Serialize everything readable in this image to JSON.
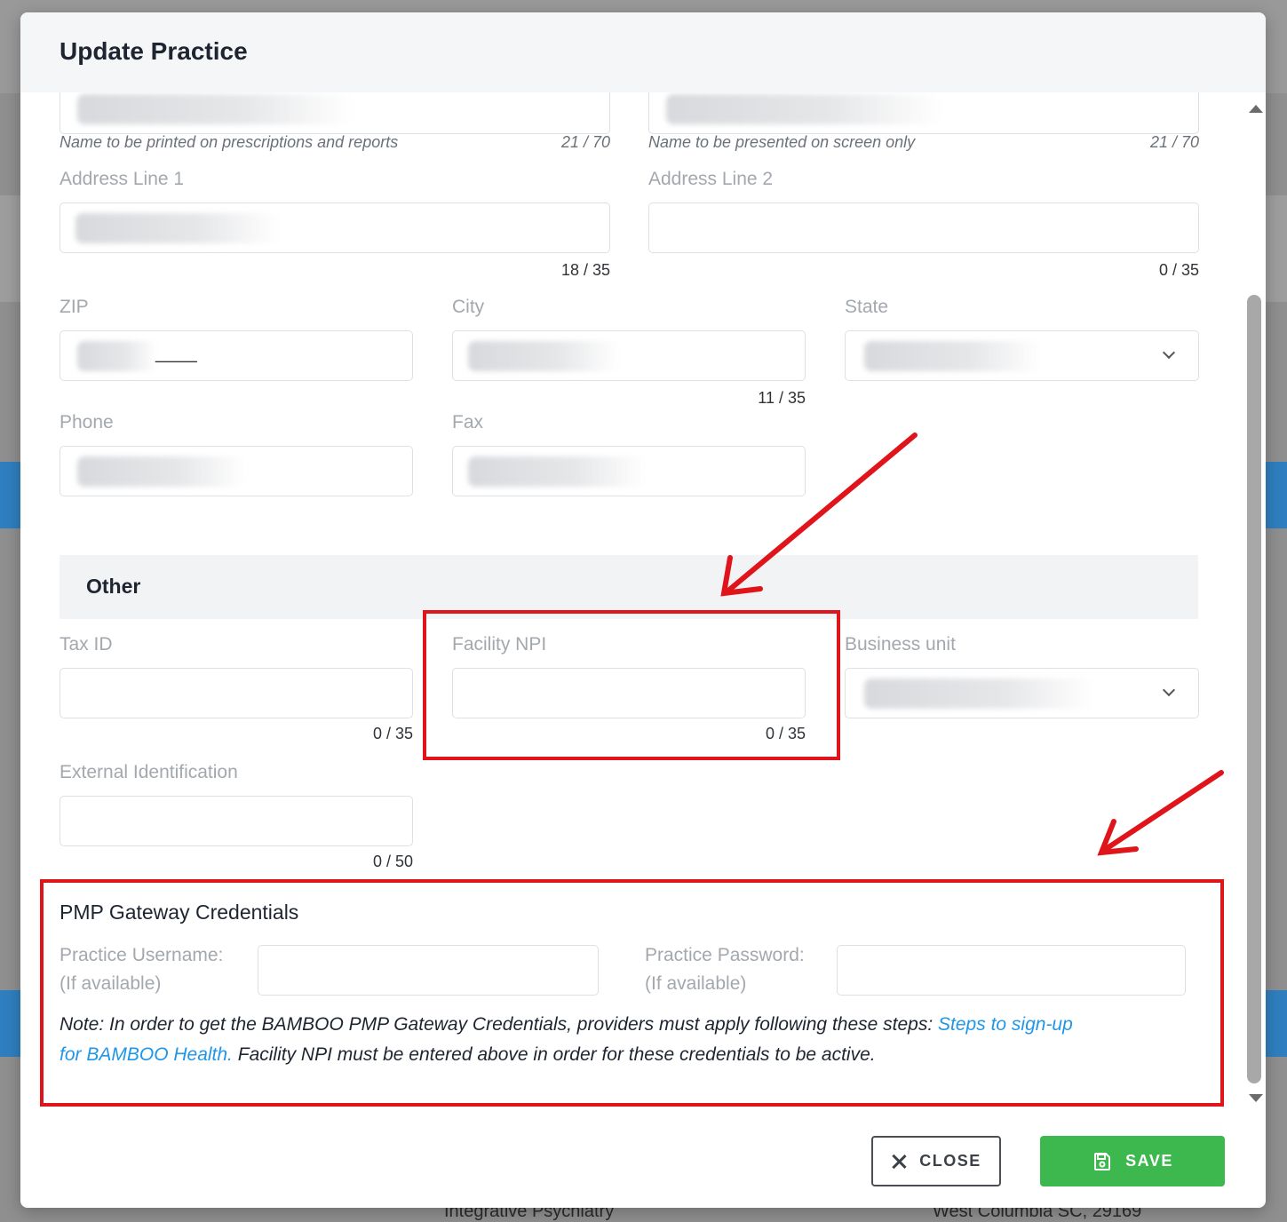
{
  "modal": {
    "title": "Update Practice"
  },
  "form": {
    "printed_name": {
      "hint": "Name to be printed on prescriptions and reports",
      "counter": "21 / 70"
    },
    "screen_name": {
      "hint": "Name to be presented on screen only",
      "counter": "21 / 70"
    },
    "address1": {
      "label": "Address Line 1",
      "counter": "18 / 35"
    },
    "address2": {
      "label": "Address Line 2",
      "counter": "0 / 35"
    },
    "zip": {
      "label": "ZIP",
      "mask": "____"
    },
    "city": {
      "label": "City",
      "counter": "11 / 35"
    },
    "state": {
      "label": "State"
    },
    "phone": {
      "label": "Phone"
    },
    "fax": {
      "label": "Fax"
    }
  },
  "other": {
    "title": "Other",
    "tax_id": {
      "label": "Tax ID",
      "counter": "0 / 35"
    },
    "facility_npi": {
      "label": "Facility NPI",
      "counter": "0 / 35"
    },
    "business_unit": {
      "label": "Business unit"
    },
    "external_id": {
      "label": "External Identification",
      "counter": "0 / 50"
    }
  },
  "pmp": {
    "title": "PMP Gateway Credentials",
    "username_label": "Practice Username:",
    "username_sub": "(If available)",
    "password_label": "Practice Password:",
    "password_sub": "(If available)",
    "note_prefix": "Note: In order to get the BAMBOO PMP Gateway Credentials, providers must apply following these steps:",
    "note_link_line1": "Steps to sign-up",
    "note_link_line2": "for BAMBOO Health.",
    "note_suffix": "Facility NPI must be entered above in order for these credentials to be active."
  },
  "footer": {
    "close_label": "CLOSE",
    "save_label": "SAVE"
  },
  "background": {
    "bottom_left": "Integrative Psychiatry",
    "bottom_right": "West Columbia SC, 29169"
  },
  "colors": {
    "annotation_red": "#e0151c",
    "save_green": "#3db84f",
    "link_blue": "#2196e8"
  }
}
